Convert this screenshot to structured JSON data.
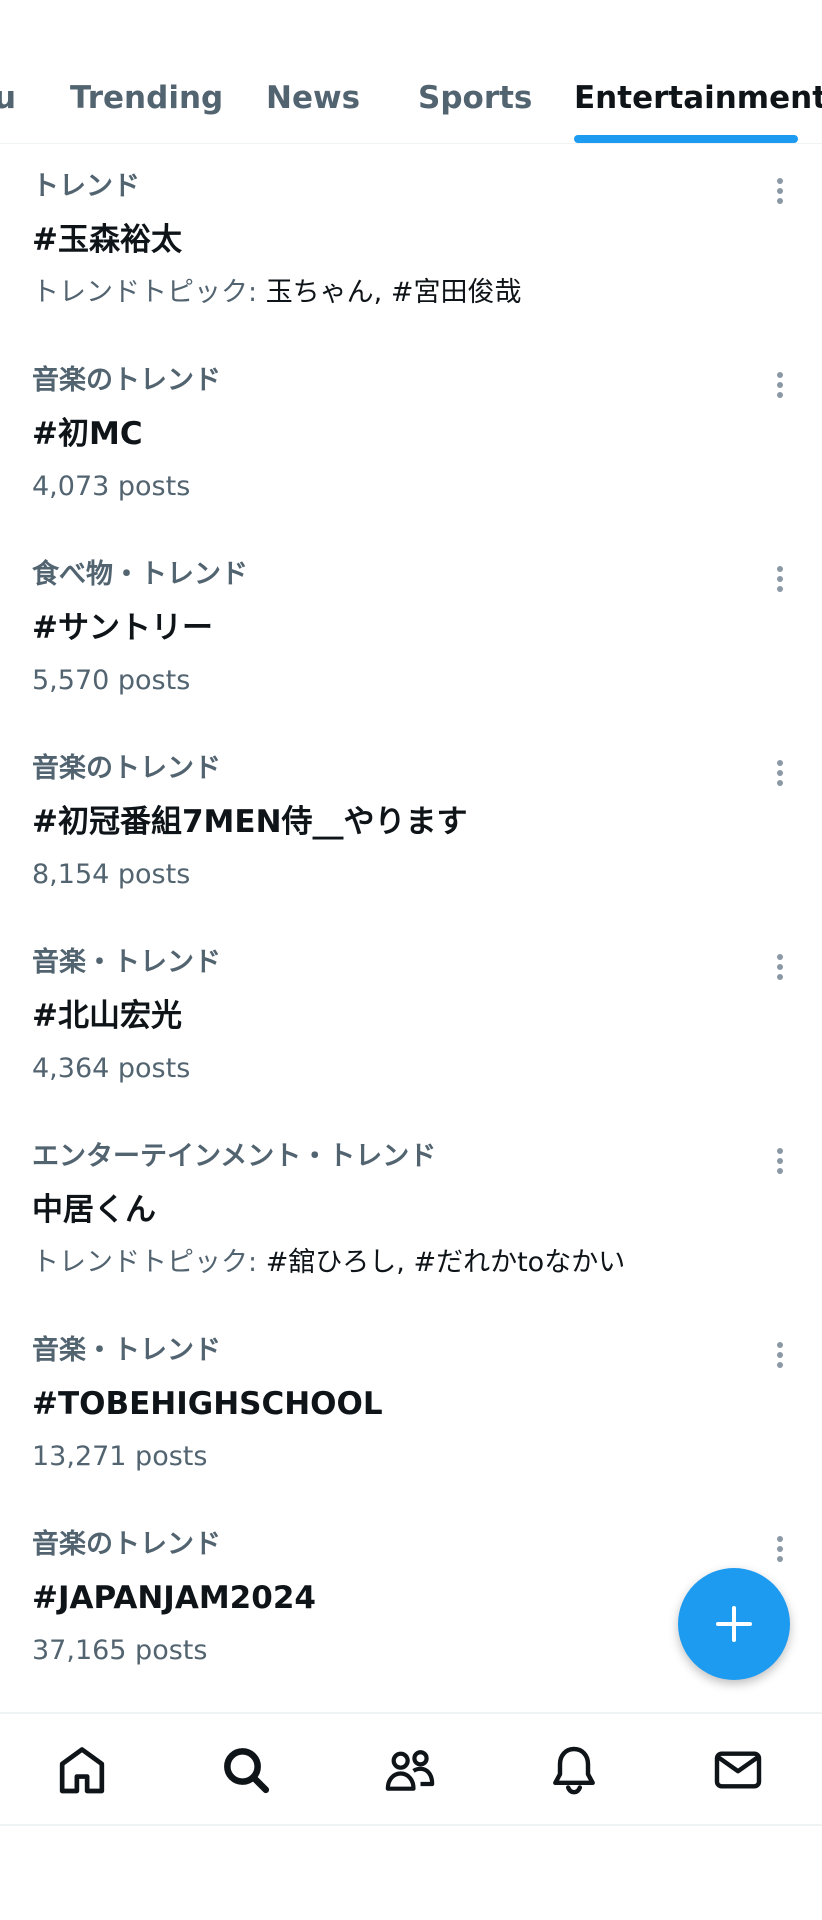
{
  "tabs": [
    {
      "label": "u"
    },
    {
      "label": "Trending"
    },
    {
      "label": "News"
    },
    {
      "label": "Sports"
    },
    {
      "label": "Entertainment",
      "active": true
    }
  ],
  "trends": [
    {
      "context": "トレンド",
      "name": "#玉森裕太",
      "meta_label": "トレンドトピック: ",
      "meta_topics": "玉ちゃん, #宮田俊哉"
    },
    {
      "context": "音楽のトレンド",
      "name": "#初MC",
      "meta_label": "4,073 posts",
      "meta_topics": ""
    },
    {
      "context": "食べ物・トレンド",
      "name": "#サントリー",
      "meta_label": "5,570 posts",
      "meta_topics": ""
    },
    {
      "context": "音楽のトレンド",
      "name": "#初冠番組7MEN侍__やります",
      "meta_label": "8,154 posts",
      "meta_topics": ""
    },
    {
      "context": "音楽・トレンド",
      "name": "#北山宏光",
      "meta_label": "4,364 posts",
      "meta_topics": ""
    },
    {
      "context": "エンターテインメント・トレンド",
      "name": "中居くん",
      "meta_label": "トレンドトピック: ",
      "meta_topics": "#舘ひろし, #だれかtoなかい"
    },
    {
      "context": "音楽・トレンド",
      "name": "#TOBEHIGHSCHOOL",
      "meta_label": "13,271 posts",
      "meta_topics": ""
    },
    {
      "context": "音楽のトレンド",
      "name": "#JAPANJAM2024",
      "meta_label": "37,165 posts",
      "meta_topics": ""
    }
  ],
  "fab": {
    "icon": "plus-icon"
  },
  "bottom_nav": [
    {
      "icon": "home-icon"
    },
    {
      "icon": "search-icon"
    },
    {
      "icon": "communities-icon"
    },
    {
      "icon": "bell-icon"
    },
    {
      "icon": "mail-icon"
    }
  ],
  "colors": {
    "accent": "#1d9bf0",
    "text_primary": "#0f1419",
    "text_secondary": "#536471",
    "divider": "#eff3f4"
  }
}
